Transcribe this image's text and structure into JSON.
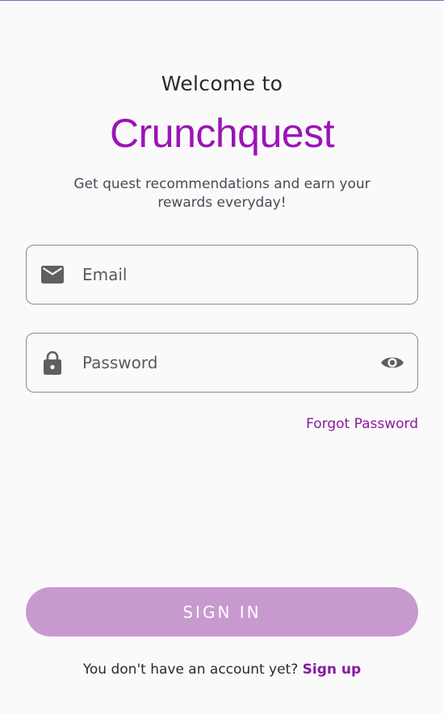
{
  "welcome": {
    "heading": "Welcome to",
    "brand": "Crunchquest",
    "tagline": "Get quest recommendations and earn your rewards everyday!"
  },
  "form": {
    "email": {
      "placeholder": "Email",
      "value": "",
      "icon": "mail-icon"
    },
    "password": {
      "placeholder": "Password",
      "value": "",
      "icon": "lock-icon",
      "toggle_icon": "eye-icon"
    },
    "forgot_label": "Forgot Password",
    "signin_label": "SIGN IN"
  },
  "signup": {
    "prompt": "You don't have an account yet?",
    "link_label": "Sign up"
  },
  "colors": {
    "brand": "#9b14b8",
    "link": "#8a1a9e",
    "button": "#c899cf",
    "background": "#fafafa"
  }
}
